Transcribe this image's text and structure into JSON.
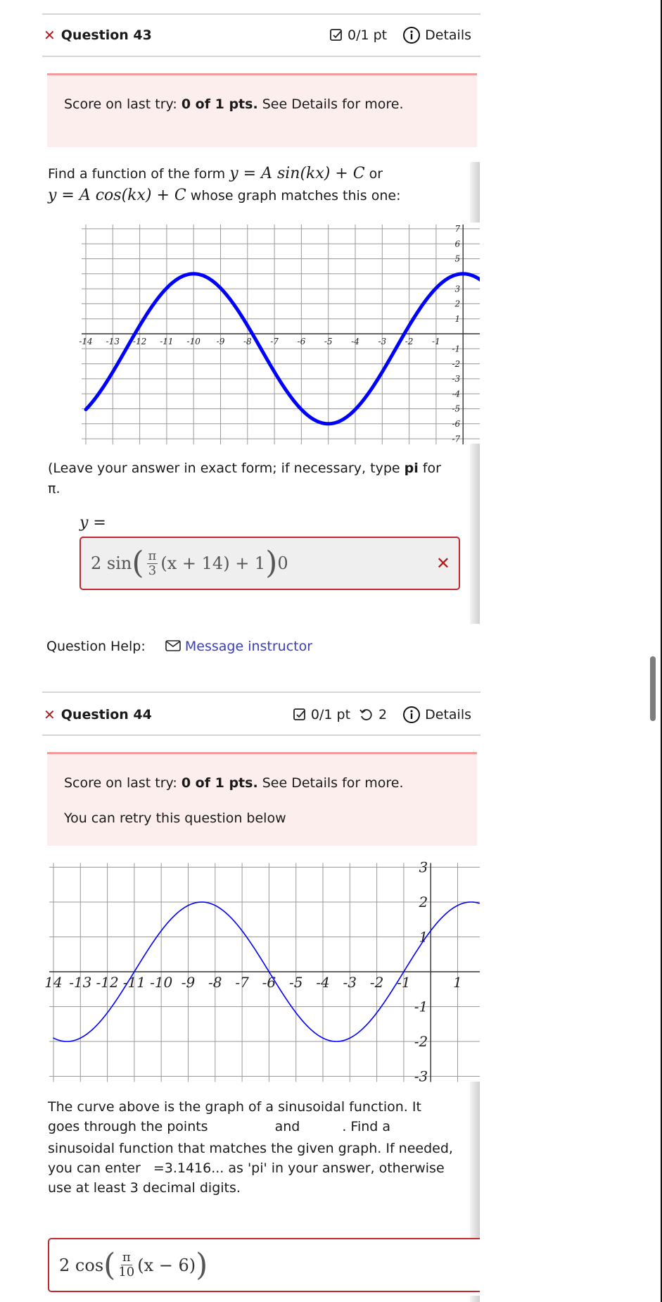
{
  "questions": [
    {
      "status_icon": "x-mark-icon",
      "title": "Question 43",
      "score_label": "0/1 pt",
      "details_label": "Details",
      "score_box": {
        "prefix": "Score on last try: ",
        "bold": "0 of 1 pts.",
        "suffix": " See Details for more."
      },
      "prompt": {
        "line1_text": "Find a function of the form ",
        "form_sin": "y = A sin(kx) + C",
        "or": " or",
        "form_cos": "y = A cos(kx) + C",
        "line2_text": " whose graph matches this one:"
      },
      "instructions": {
        "prefix": "(Leave your answer in exact form; if necessary, type ",
        "bold": "pi",
        "suffix": " for",
        "line2": "π."
      },
      "answer_label": "y =",
      "answer": {
        "coef": "2",
        "func": "sin",
        "frac_num": "π",
        "frac_den": "3",
        "inner": "(x + 14) + 1",
        "trailing": "0",
        "full_text": "2 sin( π/3 (x + 14) + 1 )0",
        "result_icon": "x-mark-icon",
        "correct": false
      },
      "help_label": "Question Help:",
      "help_link": "Message instructor"
    },
    {
      "status_icon": "x-mark-icon",
      "title": "Question 44",
      "score_label": "0/1 pt",
      "retries_label": "2",
      "details_label": "Details",
      "score_box": {
        "prefix": "Score on last try: ",
        "bold": "0 of 1 pts.",
        "suffix": " See Details for more.",
        "retry_note": "You can retry this question below"
      },
      "prompt_lines": [
        "The curve above is the graph of a sinusoidal function. It",
        "goes through the points",
        "and",
        ". Find a",
        "sinusoidal function that matches the given graph. If needed,",
        "you can enter",
        "=3.1416... as 'pi' in your answer, otherwise",
        "use at least 3 decimal digits."
      ],
      "answer": {
        "coef": "2",
        "func": "cos",
        "frac_num": "π",
        "frac_den": "10",
        "inner": "(x − 6)",
        "full_text": "2 cos( π/10 (x − 6) )",
        "correct": false
      }
    }
  ],
  "colors": {
    "incorrect": "#b01c1c",
    "score_box_bg": "#fdeeee",
    "score_box_border": "#f59a9a",
    "curve": "#0000ff",
    "link": "#3b3fb5"
  },
  "chart_data": [
    {
      "type": "line",
      "title": "",
      "xlabel": "",
      "ylabel": "",
      "xlim": [
        -14,
        0.7
      ],
      "ylim": [
        -7,
        7
      ],
      "x_ticks": [
        "-14",
        "-13",
        "-12",
        "-11",
        "-10",
        "-9",
        "-8",
        "-7",
        "-6",
        "-5",
        "-4",
        "-3",
        "-2",
        "-1"
      ],
      "y_ticks": [
        "7",
        "6",
        "5",
        "3",
        "2",
        "1",
        "-1",
        "-2",
        "-3",
        "-4",
        "-5",
        "-6",
        "-7"
      ],
      "grid": true,
      "series": [
        {
          "name": "curve",
          "function": "5*cos(pi/5*x) - 1",
          "key_points": [
            [
              -14,
              -5.05
            ],
            [
              -12.5,
              -1
            ],
            [
              -10,
              4
            ],
            [
              -7.5,
              -1
            ],
            [
              -5,
              -6
            ],
            [
              -2.5,
              -1
            ],
            [
              0,
              4
            ]
          ]
        }
      ]
    },
    {
      "type": "line",
      "title": "",
      "xlabel": "",
      "ylabel": "",
      "xlim": [
        -14,
        1.8
      ],
      "ylim": [
        -3,
        3
      ],
      "x_ticks": [
        "14",
        "-13",
        "-12",
        "-11",
        "-10",
        "-9",
        "-8",
        "-7",
        "-6",
        "-5",
        "-4",
        "-3",
        "-2",
        "-1",
        "1"
      ],
      "y_ticks": [
        "3",
        "2",
        "1",
        "-1",
        "-2",
        "-3"
      ],
      "grid": true,
      "series": [
        {
          "name": "curve",
          "function": "2*sin(pi/5*(x+1))",
          "key_points": [
            [
              -14,
              -1.9
            ],
            [
              -13.5,
              -2
            ],
            [
              -11,
              0
            ],
            [
              -8.5,
              2
            ],
            [
              -6,
              0
            ],
            [
              -3.5,
              -2
            ],
            [
              -1,
              0
            ],
            [
              1.5,
              2
            ]
          ]
        }
      ]
    }
  ],
  "scrollbar": {
    "position_fraction": 0.5
  }
}
